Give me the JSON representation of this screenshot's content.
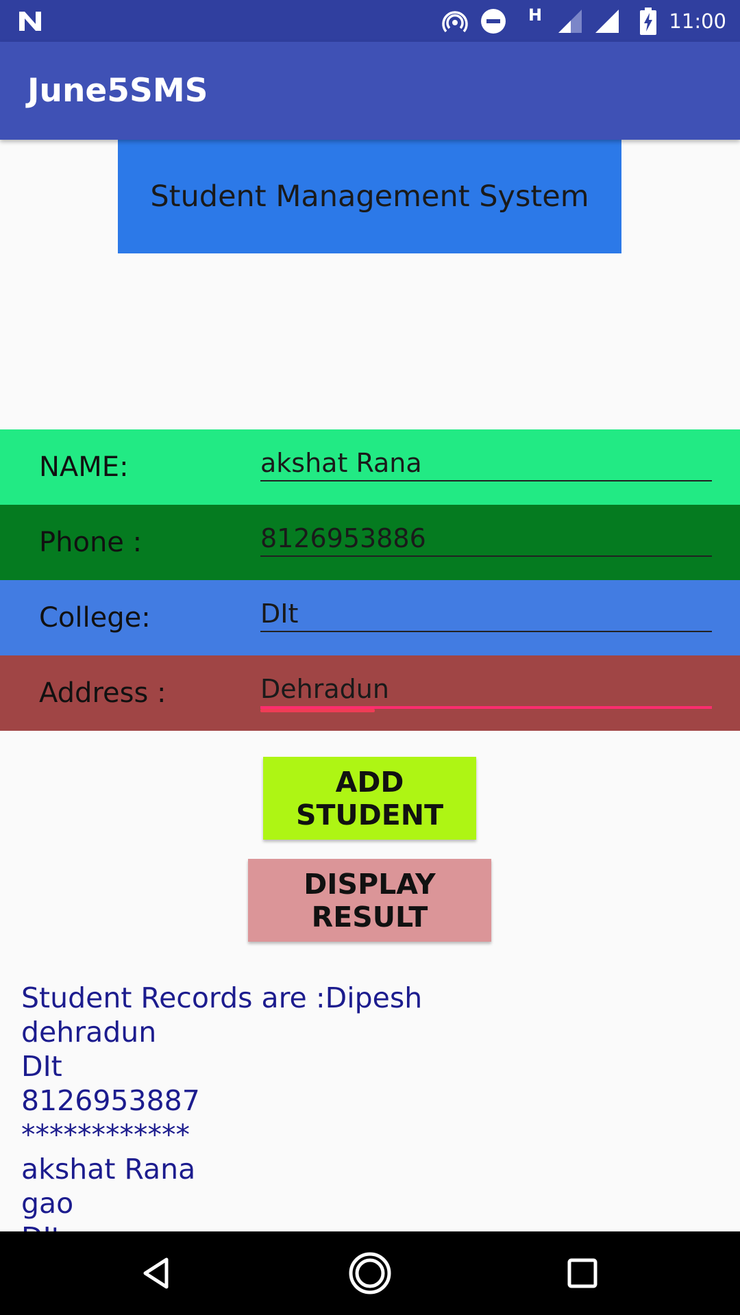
{
  "status_bar": {
    "time": "11:00",
    "network_type": "H",
    "icons": [
      "n-logo-icon",
      "hotspot-icon",
      "do-not-disturb-icon",
      "signal-icon",
      "signal-full-icon",
      "battery-charging-icon"
    ],
    "color": "#303f9f"
  },
  "app_bar": {
    "title": "June5SMS",
    "color": "#3f51b5"
  },
  "banner": {
    "text": "Student Management System",
    "color": "#2c79e8"
  },
  "form": {
    "name": {
      "label": "NAME:",
      "value": "akshat Rana",
      "color": "#22ea84"
    },
    "phone": {
      "label": "Phone :",
      "value": "8126953886",
      "color": "#057b20"
    },
    "college": {
      "label": "College:",
      "value": "DIt",
      "color": "#427ce2"
    },
    "address": {
      "label": "Address :",
      "value": "Dehradun",
      "color": "#a04545"
    }
  },
  "buttons": {
    "add_student": "ADD STUDENT",
    "display_result": "DISPLAY RESULT"
  },
  "records": {
    "lines": [
      "Student Records are :Dipesh",
      "dehradun",
      "DIt",
      "8126953887",
      "************",
      "akshat Rana",
      "gao",
      "DIt"
    ],
    "color": "#1c1c8e"
  },
  "nav_bar": {
    "icons": [
      "back-icon",
      "home-icon",
      "recents-icon"
    ]
  }
}
